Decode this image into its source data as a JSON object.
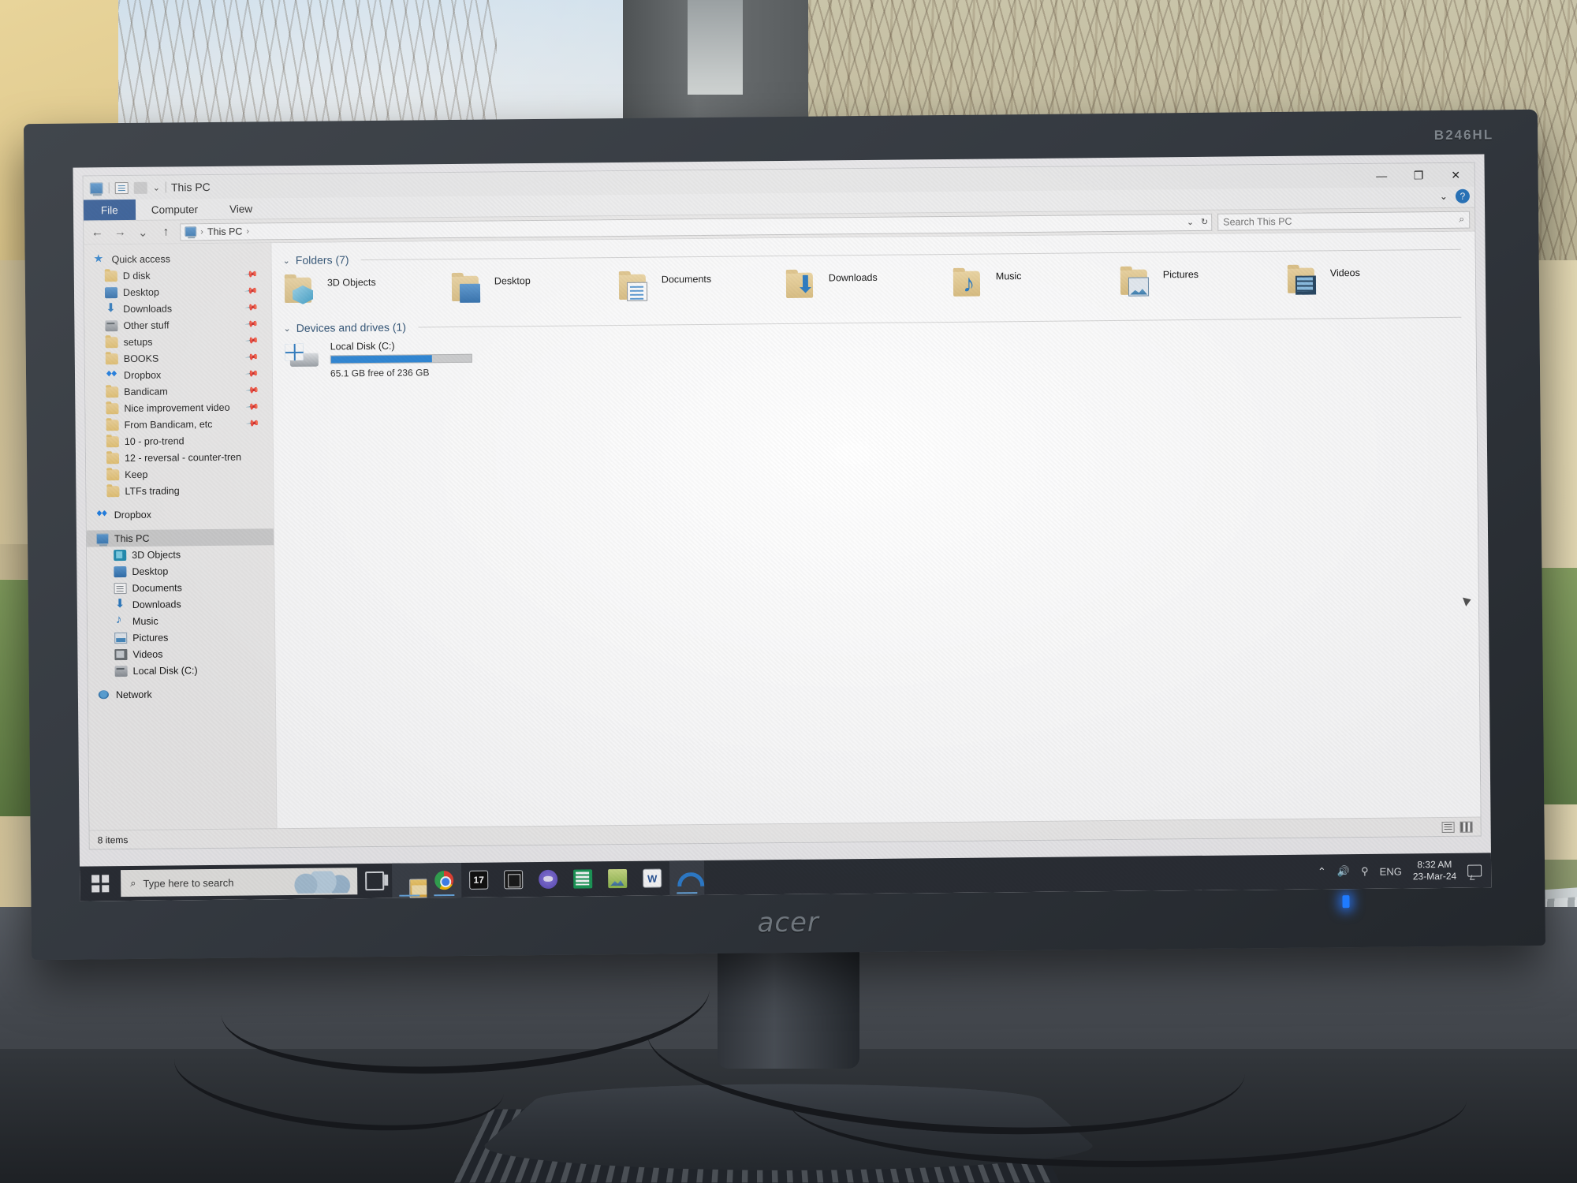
{
  "photo": {
    "monitor_brand": "acer",
    "monitor_model": "B246HL"
  },
  "window": {
    "title": "This PC",
    "quick_access_toolbar": [
      {
        "name": "this-pc-icon",
        "label": ""
      },
      {
        "name": "properties-icon",
        "label": ""
      },
      {
        "name": "new-folder-icon",
        "label": ""
      },
      {
        "name": "customize-caret",
        "label": "⌄"
      }
    ],
    "controls": {
      "minimize": "—",
      "maximize": "❐",
      "close": "✕",
      "help": "?",
      "collapse_ribbon": "⌄"
    },
    "ribbon_tabs": [
      {
        "label": "File",
        "active": true
      },
      {
        "label": "Computer",
        "active": false
      },
      {
        "label": "View",
        "active": false
      }
    ],
    "address": {
      "back": "←",
      "forward": "→",
      "recent": "⌄",
      "up": "↑",
      "crumbs": [
        "This PC"
      ],
      "separator": "›",
      "dropdown": "⌄",
      "refresh": "↻"
    },
    "search": {
      "placeholder": "Search This PC",
      "icon": "search-icon"
    }
  },
  "navpane": {
    "quick_access": {
      "label": "Quick access",
      "icon": "star-icon"
    },
    "pinned": [
      {
        "label": "D disk",
        "icon": "folder-icon",
        "pinned": true
      },
      {
        "label": "Desktop",
        "icon": "desktop-icon",
        "pinned": true
      },
      {
        "label": "Downloads",
        "icon": "downloads-icon",
        "pinned": true
      },
      {
        "label": "Other stuff",
        "icon": "drive-icon",
        "pinned": true
      },
      {
        "label": "setups",
        "icon": "folder-icon",
        "pinned": true
      },
      {
        "label": "BOOKS",
        "icon": "folder-icon",
        "pinned": true
      },
      {
        "label": "Dropbox",
        "icon": "dropbox-icon",
        "pinned": true
      },
      {
        "label": "Bandicam",
        "icon": "folder-icon",
        "pinned": true
      },
      {
        "label": "Nice improvement video",
        "icon": "folder-icon",
        "pinned": true
      },
      {
        "label": "From Bandicam, etc",
        "icon": "folder-icon",
        "pinned": true
      },
      {
        "label": "10 - pro-trend",
        "icon": "folder-icon",
        "pinned": false
      },
      {
        "label": "12 - reversal - counter-tren",
        "icon": "folder-icon",
        "pinned": false
      },
      {
        "label": "Keep",
        "icon": "folder-icon",
        "pinned": false
      },
      {
        "label": "LTFs trading",
        "icon": "folder-icon",
        "pinned": false
      }
    ],
    "dropbox": {
      "label": "Dropbox",
      "icon": "dropbox-icon"
    },
    "this_pc": {
      "label": "This PC",
      "icon": "this-pc-icon",
      "selected": true
    },
    "this_pc_children": [
      {
        "label": "3D Objects",
        "icon": "3d-objects-icon"
      },
      {
        "label": "Desktop",
        "icon": "desktop-icon"
      },
      {
        "label": "Documents",
        "icon": "documents-icon"
      },
      {
        "label": "Downloads",
        "icon": "downloads-icon"
      },
      {
        "label": "Music",
        "icon": "music-icon"
      },
      {
        "label": "Pictures",
        "icon": "pictures-icon"
      },
      {
        "label": "Videos",
        "icon": "videos-icon"
      },
      {
        "label": "Local Disk (C:)",
        "icon": "drive-icon"
      }
    ],
    "network": {
      "label": "Network",
      "icon": "network-icon"
    }
  },
  "content": {
    "folders_group": {
      "label": "Folders (7)",
      "chevron": "⌄"
    },
    "folders": [
      {
        "label": "3D Objects",
        "icon": "folder-3d-objects-icon"
      },
      {
        "label": "Desktop",
        "icon": "folder-desktop-icon"
      },
      {
        "label": "Documents",
        "icon": "folder-documents-icon"
      },
      {
        "label": "Downloads",
        "icon": "folder-downloads-icon"
      },
      {
        "label": "Music",
        "icon": "folder-music-icon"
      },
      {
        "label": "Pictures",
        "icon": "folder-pictures-icon"
      },
      {
        "label": "Videos",
        "icon": "folder-videos-icon"
      }
    ],
    "devices_group": {
      "label": "Devices and drives (1)",
      "chevron": "⌄"
    },
    "drives": [
      {
        "name": "Local Disk (C:)",
        "free_text": "65.1 GB free of 236 GB",
        "free_gb": 65.1,
        "total_gb": 236,
        "used_percent": 72,
        "bar_color": "#2785d8"
      }
    ]
  },
  "statusbar": {
    "items_text": "8 items",
    "view_buttons": [
      {
        "name": "details-view-button"
      },
      {
        "name": "large-icons-view-button"
      }
    ]
  },
  "taskbar": {
    "start": {
      "name": "start-button"
    },
    "search": {
      "placeholder": "Type here to search"
    },
    "task_view": {
      "name": "task-view-button"
    },
    "apps": [
      {
        "name": "file-explorer-taskbar-icon",
        "active": true
      },
      {
        "name": "google-chrome-taskbar-icon",
        "active": true
      },
      {
        "name": "tradingview-taskbar-icon",
        "label": "17",
        "active": false
      },
      {
        "name": "onenote-taskbar-icon",
        "active": false
      },
      {
        "name": "discord-taskbar-icon",
        "active": false
      },
      {
        "name": "excel-taskbar-icon",
        "active": false
      },
      {
        "name": "paint-taskbar-icon",
        "active": false
      },
      {
        "name": "word-taskbar-icon",
        "label": "W",
        "active": false
      },
      {
        "name": "arc-browser-taskbar-icon",
        "active": true
      }
    ],
    "tray": {
      "show_hidden": "⌃",
      "volume": "volume-icon",
      "network": "network-icon",
      "language": "ENG",
      "time": "8:32 AM",
      "date": "23-Mar-24",
      "action_center": "action-center-icon"
    }
  }
}
